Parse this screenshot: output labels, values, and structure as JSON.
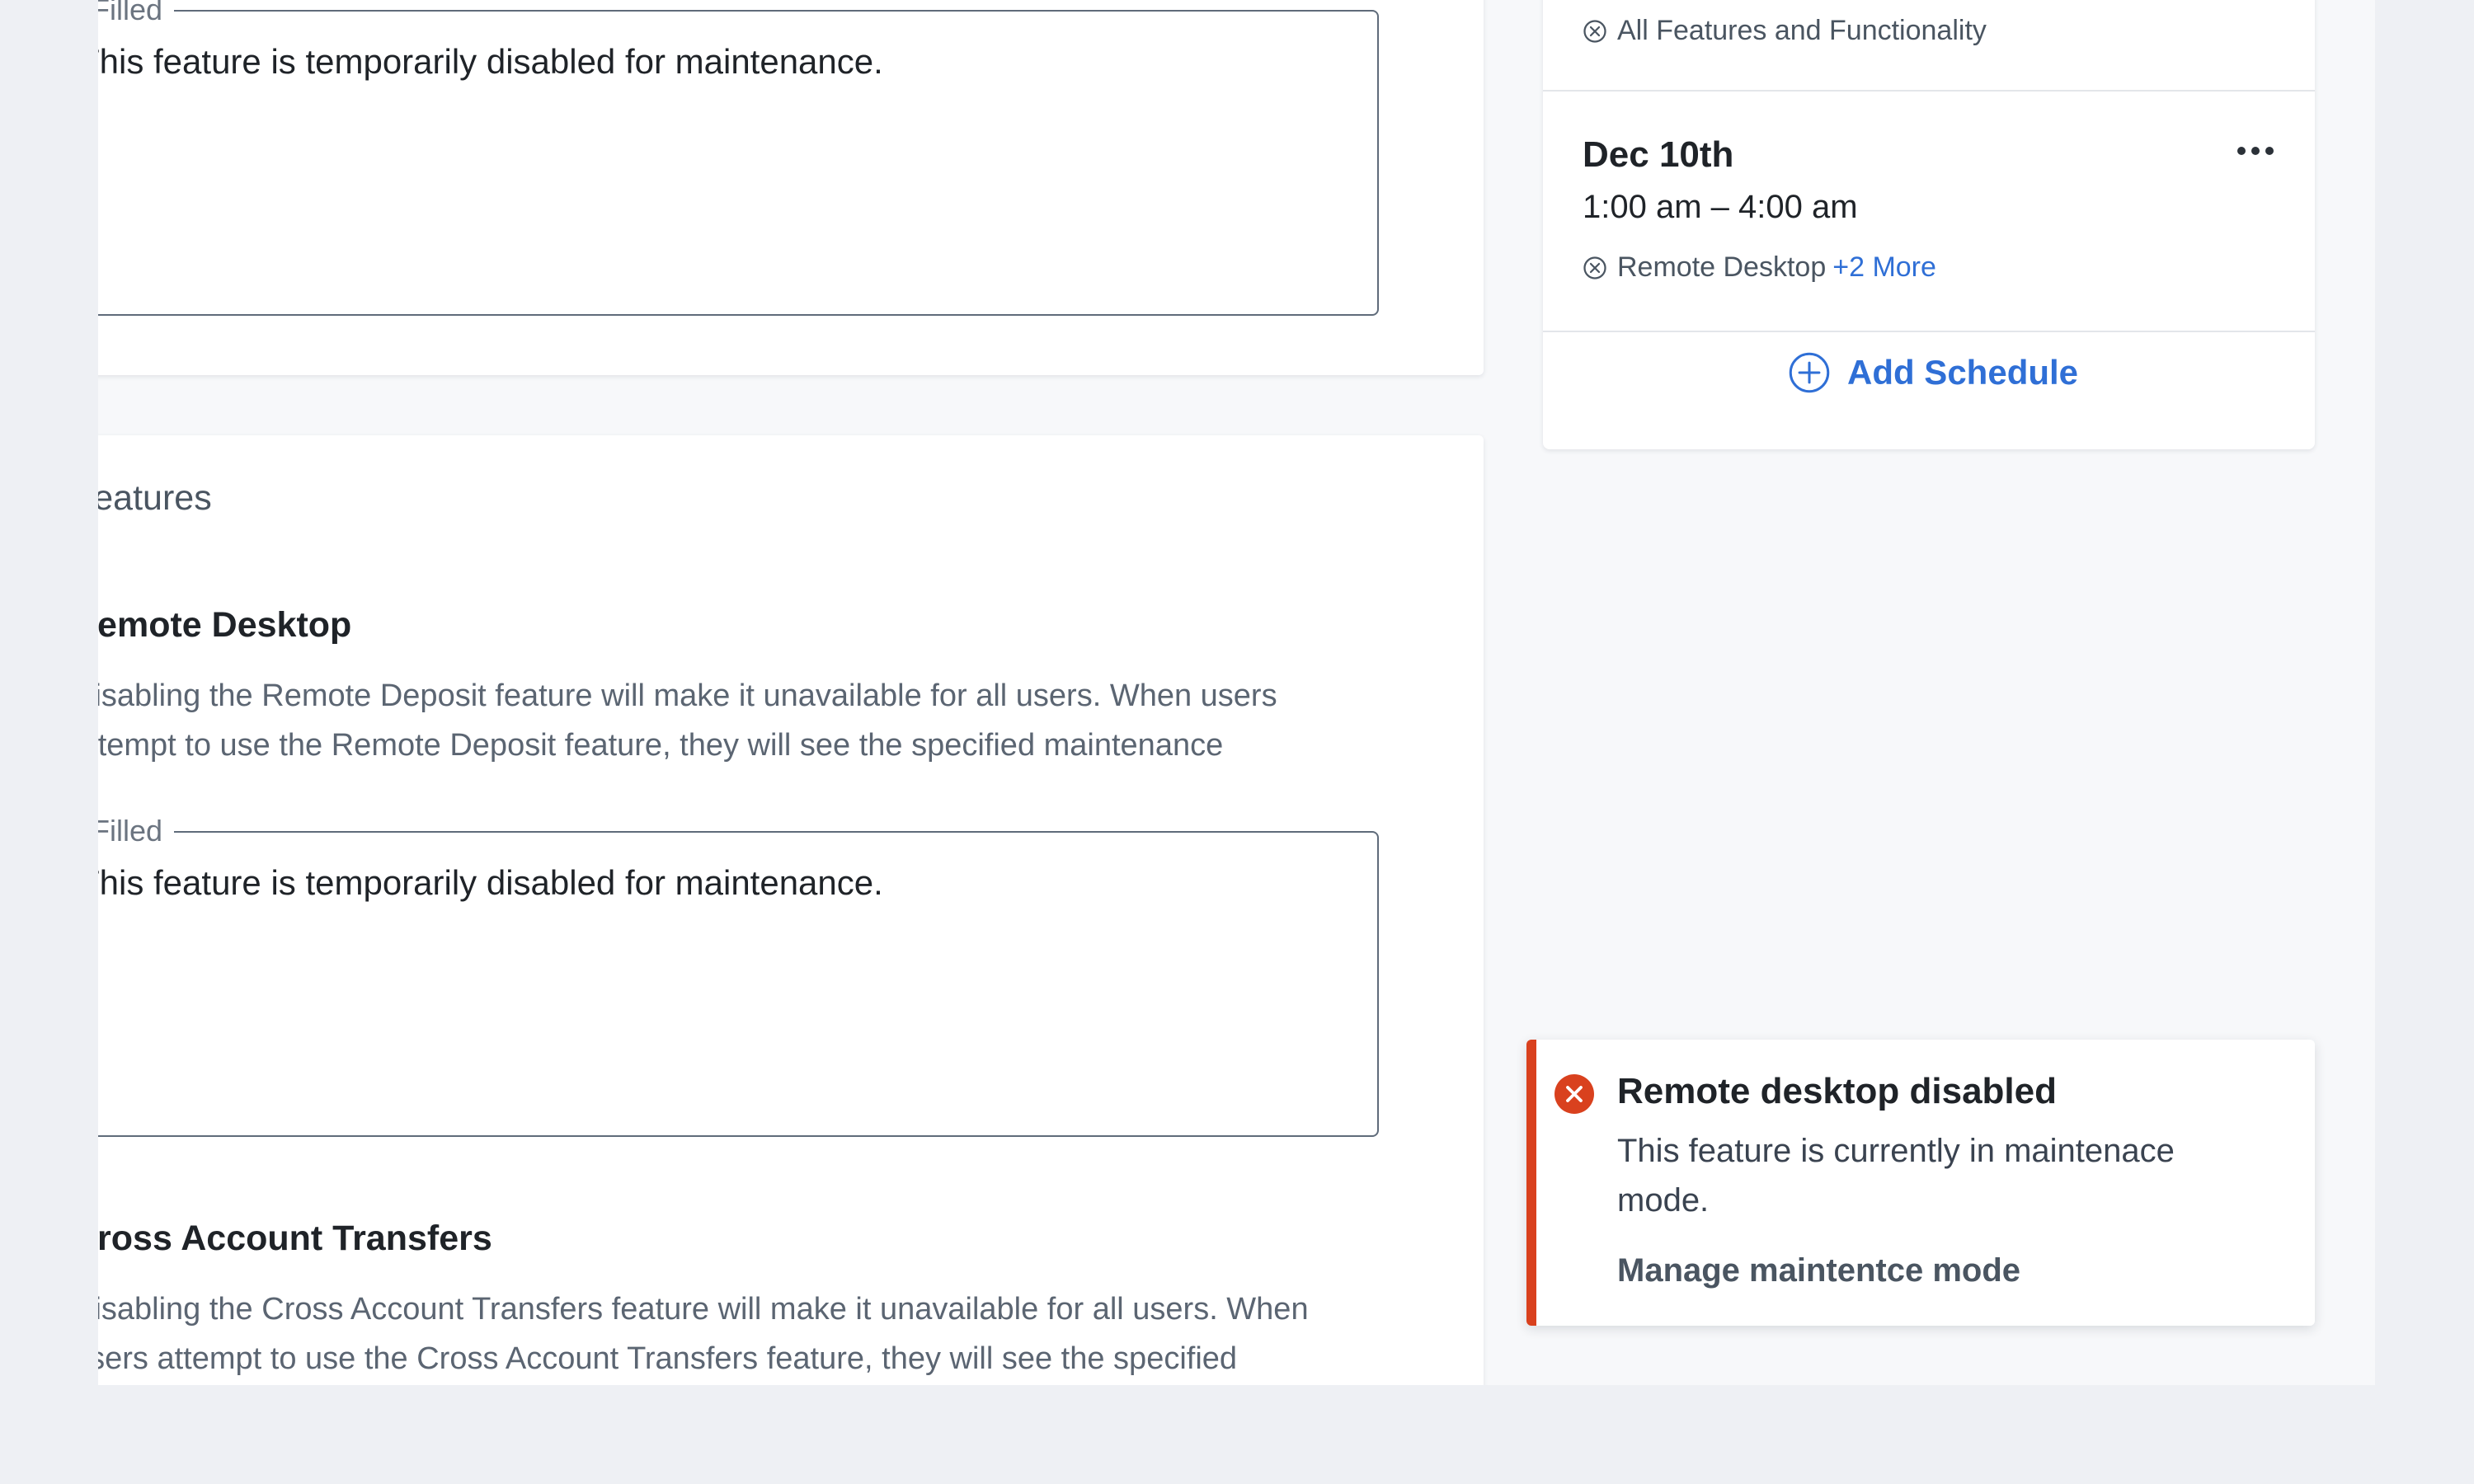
{
  "maintenance_message": {
    "label": "Filled",
    "value": "This feature is temporarily disabled for maintenance."
  },
  "features_section": {
    "title": "Features",
    "items": [
      {
        "title": "Remote Desktop",
        "description_line1": "Disabling the Remote Deposit feature will make it unavailable for all users. When users",
        "description_line2": "attempt to use the Remote Deposit feature, they will see the specified maintenance",
        "field_label": "Filled",
        "field_value": "This feature is temporarily disabled for maintenance."
      },
      {
        "title": "Cross Account Transfers",
        "description_line1": "Disabling the Cross Account Transfers feature will make it unavailable for all users. When",
        "description_line2": "users attempt to use the Cross Account Transfers feature, they will see the specified"
      }
    ]
  },
  "schedules": {
    "first": {
      "feature_chip": "All Features and Functionality"
    },
    "second": {
      "date": "Dec 10th",
      "time_range": "1:00 am – 4:00 am",
      "feature_chip": "Remote Desktop",
      "more_link": "+2 More"
    },
    "add_label": "Add Schedule"
  },
  "toast": {
    "title": "Remote desktop disabled",
    "body": "This feature is currently in maintenace mode.",
    "action": "Manage maintentce mode"
  },
  "colors": {
    "accent_blue": "#2f6fd6",
    "error_red": "#d9411e",
    "page_bg": "#eef0f4"
  },
  "icons": {
    "chip_icon": "x-circle-icon",
    "add_icon": "plus-circle-icon",
    "toast_icon": "error-circle-icon",
    "menu_icon": "more-horizontal-icon"
  }
}
